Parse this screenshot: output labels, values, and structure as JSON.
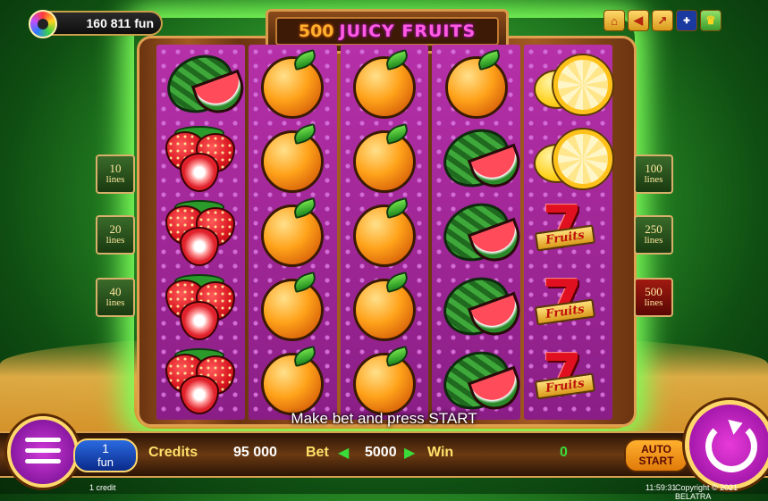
{
  "balance": {
    "value": "160 811 fun"
  },
  "title": {
    "part1": "500",
    "part2": "JUICY FRUITS"
  },
  "top_icons": [
    "home-icon",
    "sound-icon",
    "exit-icon",
    "language-flag-icon",
    "trophy-icon"
  ],
  "lines_left": [
    {
      "num": "10",
      "unit": "lines"
    },
    {
      "num": "20",
      "unit": "lines"
    },
    {
      "num": "40",
      "unit": "lines"
    }
  ],
  "lines_right": [
    {
      "num": "100",
      "unit": "lines"
    },
    {
      "num": "250",
      "unit": "lines"
    },
    {
      "num": "500",
      "unit": "lines",
      "active": true
    }
  ],
  "reels": [
    [
      "watermelon",
      "strawberry",
      "strawberry",
      "strawberry",
      "strawberry"
    ],
    [
      "orange",
      "orange",
      "orange",
      "orange",
      "orange"
    ],
    [
      "orange",
      "orange",
      "orange",
      "orange",
      "orange"
    ],
    [
      "orange",
      "watermelon",
      "watermelon",
      "watermelon",
      "watermelon"
    ],
    [
      "lemon",
      "lemon",
      "seven",
      "seven",
      "seven"
    ]
  ],
  "seven_label": "Fruits",
  "message": "Make bet and press START",
  "bottom": {
    "coin_value": "1",
    "coin_unit": "fun",
    "credits_label": "Credits",
    "credits_value": "95 000",
    "bet_label": "Bet",
    "bet_value": "5000",
    "win_label": "Win",
    "win_value": "0",
    "auto_line1": "AUTO",
    "auto_line2": "START",
    "coin_caption": "1 credit",
    "clock": "11:59:31",
    "copyright": "Copyright © 2021 BELATRA"
  },
  "colors": {
    "accent_green": "#3adc3a",
    "label_gold": "#ffe06a",
    "frame_brown": "#6b3410"
  }
}
